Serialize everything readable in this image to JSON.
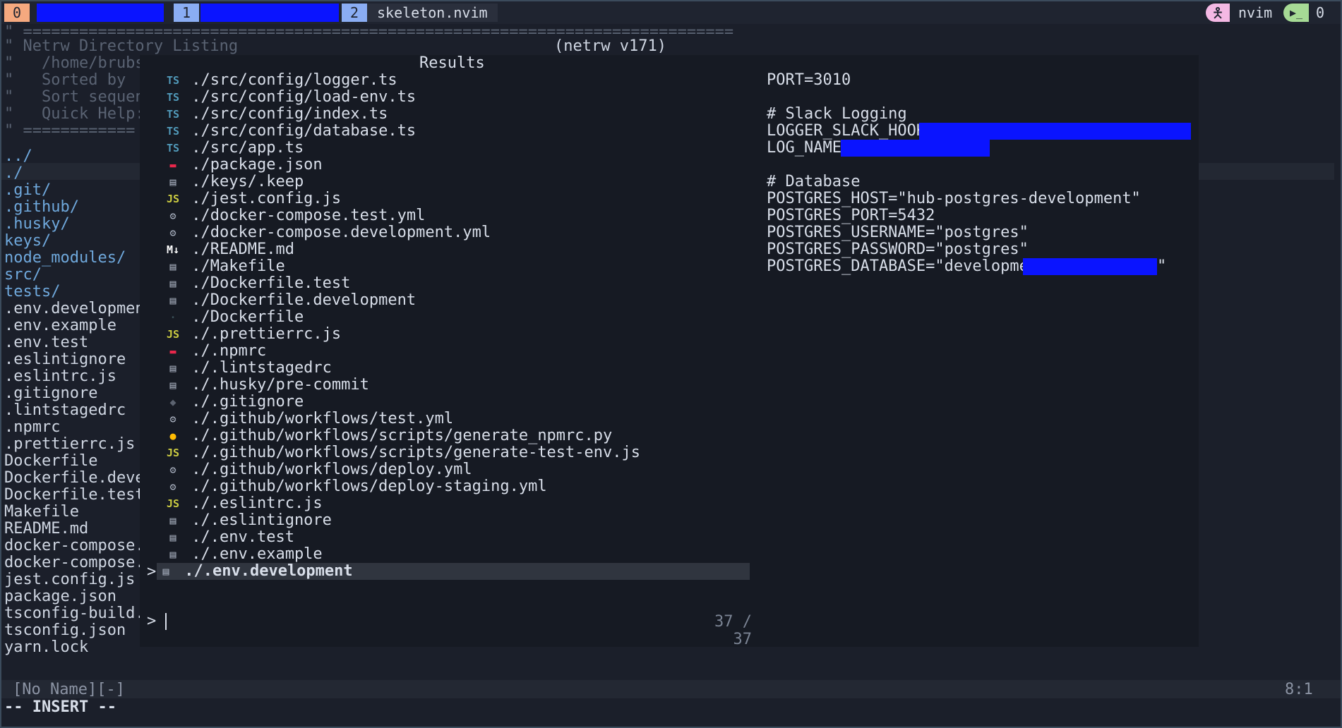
{
  "tmux": {
    "session_index": "0",
    "window1_index": "1",
    "window2_index": "2",
    "window2_title": "skeleton.nvim",
    "right_app": "nvim",
    "right_count": "0"
  },
  "netrw": {
    "header": [
      "\" ============================================================================",
      "\" Netrw Directory Listing",
      "\"   /home/brubs/",
      "\"   Sorted by",
      "\"   Sort sequenc",
      "\"   Quick Help:",
      "\" ============"
    ],
    "version": "(netrw v171)",
    "entries": [
      {
        "name": "../",
        "kind": "dir"
      },
      {
        "name": "./",
        "kind": "dir"
      },
      {
        "name": ".git/",
        "kind": "dir"
      },
      {
        "name": ".github/",
        "kind": "dir"
      },
      {
        "name": ".husky/",
        "kind": "dir"
      },
      {
        "name": "keys/",
        "kind": "dir"
      },
      {
        "name": "node_modules/",
        "kind": "dir"
      },
      {
        "name": "src/",
        "kind": "dir"
      },
      {
        "name": "tests/",
        "kind": "dir"
      },
      {
        "name": ".env.development",
        "kind": "file"
      },
      {
        "name": ".env.example",
        "kind": "file"
      },
      {
        "name": ".env.test",
        "kind": "file"
      },
      {
        "name": ".eslintignore",
        "kind": "file"
      },
      {
        "name": ".eslintrc.js",
        "kind": "file"
      },
      {
        "name": ".gitignore",
        "kind": "file"
      },
      {
        "name": ".lintstagedrc",
        "kind": "file"
      },
      {
        "name": ".npmrc",
        "kind": "file"
      },
      {
        "name": ".prettierrc.js",
        "kind": "file"
      },
      {
        "name": "Dockerfile",
        "kind": "file"
      },
      {
        "name": "Dockerfile.devel",
        "kind": "file"
      },
      {
        "name": "Dockerfile.test",
        "kind": "file"
      },
      {
        "name": "Makefile",
        "kind": "file"
      },
      {
        "name": "README.md",
        "kind": "file"
      },
      {
        "name": "docker-compose.d",
        "kind": "file"
      },
      {
        "name": "docker-compose.t",
        "kind": "file"
      },
      {
        "name": "jest.config.js",
        "kind": "file"
      },
      {
        "name": "package.json",
        "kind": "file"
      },
      {
        "name": "tsconfig-build.j",
        "kind": "file"
      },
      {
        "name": "tsconfig.json",
        "kind": "file"
      },
      {
        "name": "yarn.lock",
        "kind": "file"
      }
    ]
  },
  "telescope": {
    "results_title": "Results",
    "results": [
      {
        "icon": "TS",
        "icon_name": "typescript-icon",
        "color": "#519aba",
        "path": "./src/config/logger.ts"
      },
      {
        "icon": "TS",
        "icon_name": "typescript-icon",
        "color": "#519aba",
        "path": "./src/config/load-env.ts"
      },
      {
        "icon": "TS",
        "icon_name": "typescript-icon",
        "color": "#519aba",
        "path": "./src/config/index.ts"
      },
      {
        "icon": "TS",
        "icon_name": "typescript-icon",
        "color": "#519aba",
        "path": "./src/config/database.ts"
      },
      {
        "icon": "TS",
        "icon_name": "typescript-icon",
        "color": "#519aba",
        "path": "./src/app.ts"
      },
      {
        "icon": "▬",
        "icon_name": "npm-icon",
        "color": "#e8274b",
        "path": "./package.json"
      },
      {
        "icon": "▤",
        "icon_name": "file-icon",
        "color": "#a8b0bf",
        "path": "./keys/.keep"
      },
      {
        "icon": "JS",
        "icon_name": "javascript-icon",
        "color": "#cbcb41",
        "path": "./jest.config.js"
      },
      {
        "icon": "⚙",
        "icon_name": "gear-icon",
        "color": "#a8b0bf",
        "path": "./docker-compose.test.yml"
      },
      {
        "icon": "⚙",
        "icon_name": "gear-icon",
        "color": "#a8b0bf",
        "path": "./docker-compose.development.yml"
      },
      {
        "icon": "M↓",
        "icon_name": "markdown-icon",
        "color": "#ffffff",
        "path": "./README.md"
      },
      {
        "icon": "▤",
        "icon_name": "file-icon",
        "color": "#a8b0bf",
        "path": "./Makefile"
      },
      {
        "icon": "▤",
        "icon_name": "file-icon",
        "color": "#a8b0bf",
        "path": "./Dockerfile.test"
      },
      {
        "icon": "▤",
        "icon_name": "file-icon",
        "color": "#a8b0bf",
        "path": "./Dockerfile.development"
      },
      {
        "icon": "·",
        "icon_name": "docker-icon",
        "color": "#384d54",
        "path": "./Dockerfile"
      },
      {
        "icon": "JS",
        "icon_name": "javascript-icon",
        "color": "#cbcb41",
        "path": "./.prettierrc.js"
      },
      {
        "icon": "▬",
        "icon_name": "npm-icon",
        "color": "#e8274b",
        "path": "./.npmrc"
      },
      {
        "icon": "▤",
        "icon_name": "file-icon",
        "color": "#a8b0bf",
        "path": "./.lintstagedrc"
      },
      {
        "icon": "▤",
        "icon_name": "file-icon",
        "color": "#a8b0bf",
        "path": "./.husky/pre-commit"
      },
      {
        "icon": "◆",
        "icon_name": "git-icon",
        "color": "#5c6370",
        "path": "./.gitignore"
      },
      {
        "icon": "⚙",
        "icon_name": "gear-icon",
        "color": "#a8b0bf",
        "path": "./.github/workflows/test.yml"
      },
      {
        "icon": "●",
        "icon_name": "python-icon",
        "color": "#ffbc03",
        "path": "./.github/workflows/scripts/generate_npmrc.py"
      },
      {
        "icon": "JS",
        "icon_name": "javascript-icon",
        "color": "#cbcb41",
        "path": "./.github/workflows/scripts/generate-test-env.js"
      },
      {
        "icon": "⚙",
        "icon_name": "gear-icon",
        "color": "#a8b0bf",
        "path": "./.github/workflows/deploy.yml"
      },
      {
        "icon": "⚙",
        "icon_name": "gear-icon",
        "color": "#a8b0bf",
        "path": "./.github/workflows/deploy-staging.yml"
      },
      {
        "icon": "JS",
        "icon_name": "javascript-icon",
        "color": "#cbcb41",
        "path": "./.eslintrc.js"
      },
      {
        "icon": "▤",
        "icon_name": "file-icon",
        "color": "#a8b0bf",
        "path": "./.eslintignore"
      },
      {
        "icon": "▤",
        "icon_name": "file-icon",
        "color": "#a8b0bf",
        "path": "./.env.test"
      },
      {
        "icon": "▤",
        "icon_name": "file-icon",
        "color": "#a8b0bf",
        "path": "./.env.example"
      },
      {
        "icon": "▤",
        "icon_name": "file-icon",
        "color": "#a8b0bf",
        "path": "./.env.development"
      }
    ],
    "selection_caret": ">",
    "prompt": ">",
    "count": "37 / 37",
    "preview": [
      "PORT=3010",
      "",
      "# Slack Logging",
      "LOGGER_SLACK_HOOK=",
      "LOG_NAME=",
      "",
      "# Database",
      "POSTGRES_HOST=\"hub-postgres-development\"",
      "POSTGRES_PORT=5432",
      "POSTGRES_USERNAME=\"postgres\"",
      "POSTGRES_PASSWORD=\"postgres\"",
      "POSTGRES_DATABASE=\"development_",
      "\""
    ]
  },
  "status": {
    "left": "[No Name][-]",
    "right": "8:1",
    "mode": "-- INSERT --"
  },
  "colors": {
    "accent_orange": "#f5a97f",
    "accent_blue": "#8aadf4",
    "redaction": "#0a14ff"
  }
}
